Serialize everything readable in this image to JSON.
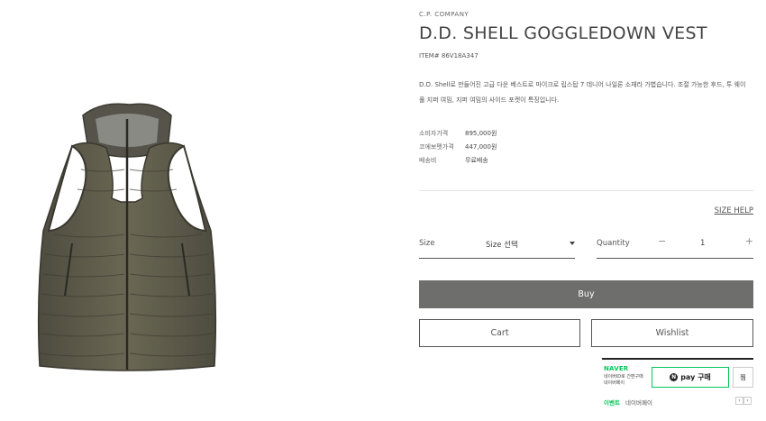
{
  "product": {
    "brand": "C.P. COMPANY",
    "title": "D.D. SHELL GOGGLEDOWN VEST",
    "item_number": "ITEM# 86V18A347",
    "description": "D.D. Shell로 만들어진 고급 다운 베스트로 마이크로 립스탑 7 데니어 나일론 소재라 가볍습니다. 조절 가능한 후드, 투 웨이 풀 지퍼 여밈, 지퍼 여밈의 사이드 포켓이 특징입니다.",
    "image_alt": "olive green quilted down vest with hood"
  },
  "prices": [
    {
      "label": "소비자가격",
      "value": "895,000원"
    },
    {
      "label": "코에보펫가격",
      "value": "447,000원"
    },
    {
      "label": "배송비",
      "value": "무료배송"
    }
  ],
  "size_help": "SIZE HELP",
  "size": {
    "label": "Size",
    "selected": "Size 선택"
  },
  "quantity": {
    "label": "Quantity",
    "value": "1",
    "minus": "−",
    "plus": "+"
  },
  "buttons": {
    "buy": "Buy",
    "cart": "Cart",
    "wishlist": "Wishlist"
  },
  "naver": {
    "logo": "NAVER",
    "line1": "네이버ID로 간편구매",
    "line2": "네이버페이",
    "pay_label": "pay 구매",
    "jjim_label": "찜",
    "event_tag": "이벤트",
    "event_text": "네이버페이"
  },
  "colors": {
    "buy_bg": "#6e6e6c",
    "naver_green": "#03c75a"
  }
}
